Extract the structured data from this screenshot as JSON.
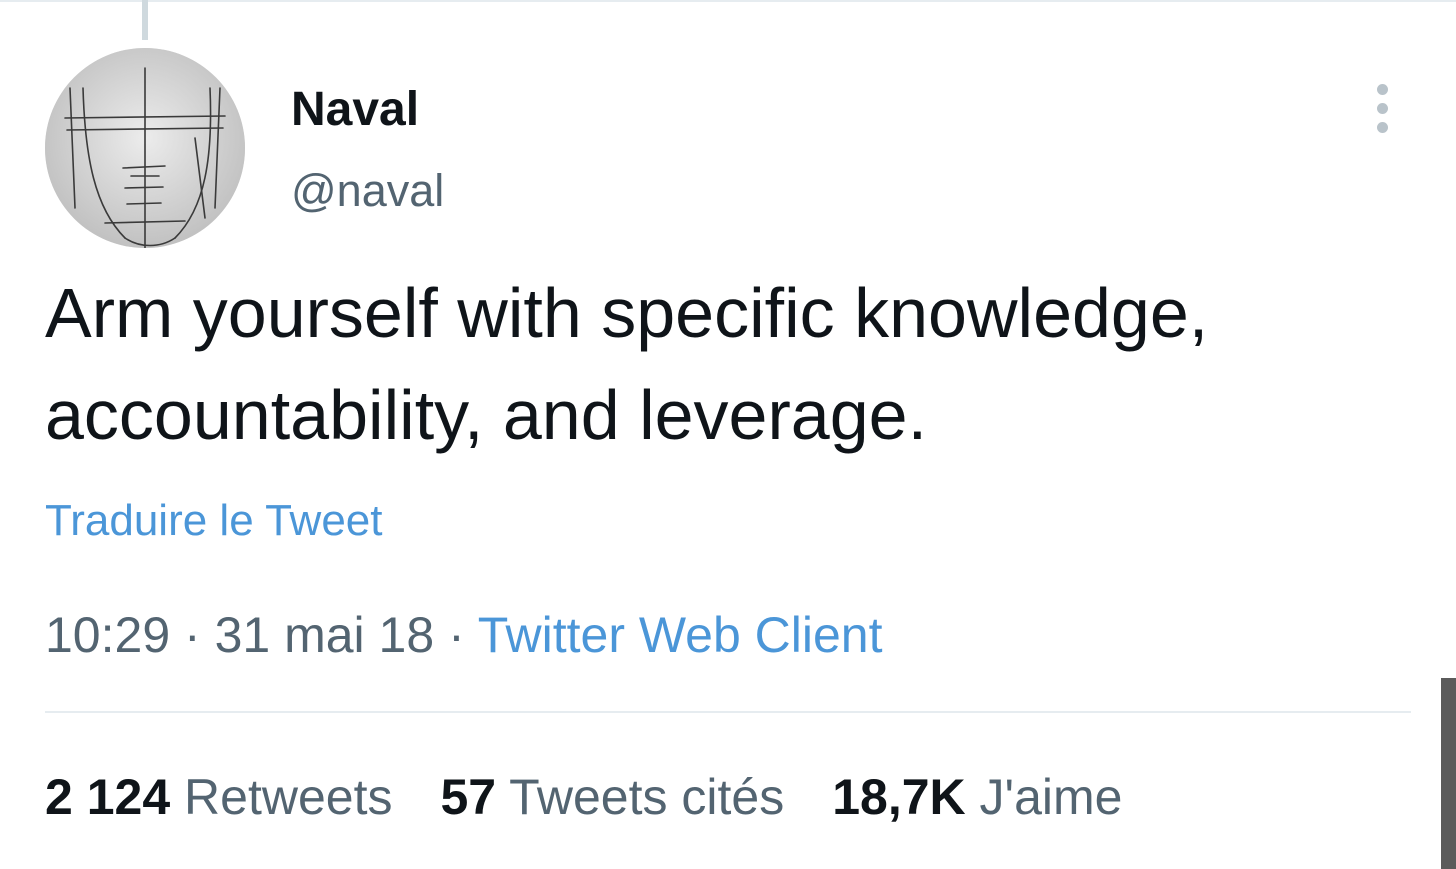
{
  "tweet": {
    "author": {
      "display_name": "Naval",
      "handle": "@naval"
    },
    "text": "Arm yourself with specific knowledge, accountability, and leverage.",
    "translate_label": "Traduire le Tweet",
    "time": "10:29",
    "separator": "·",
    "date": "31 mai 18",
    "source": "Twitter Web Client",
    "stats": [
      {
        "count": "2 124",
        "label": "Retweets"
      },
      {
        "count": "57",
        "label": "Tweets cités"
      },
      {
        "count": "18,7K",
        "label": "J'aime"
      }
    ],
    "more_icon": "more-vertical-icon"
  },
  "colors": {
    "text_primary": "#0f1419",
    "text_secondary": "#536471",
    "link": "#4b96d8",
    "divider": "#e6ecf0"
  }
}
